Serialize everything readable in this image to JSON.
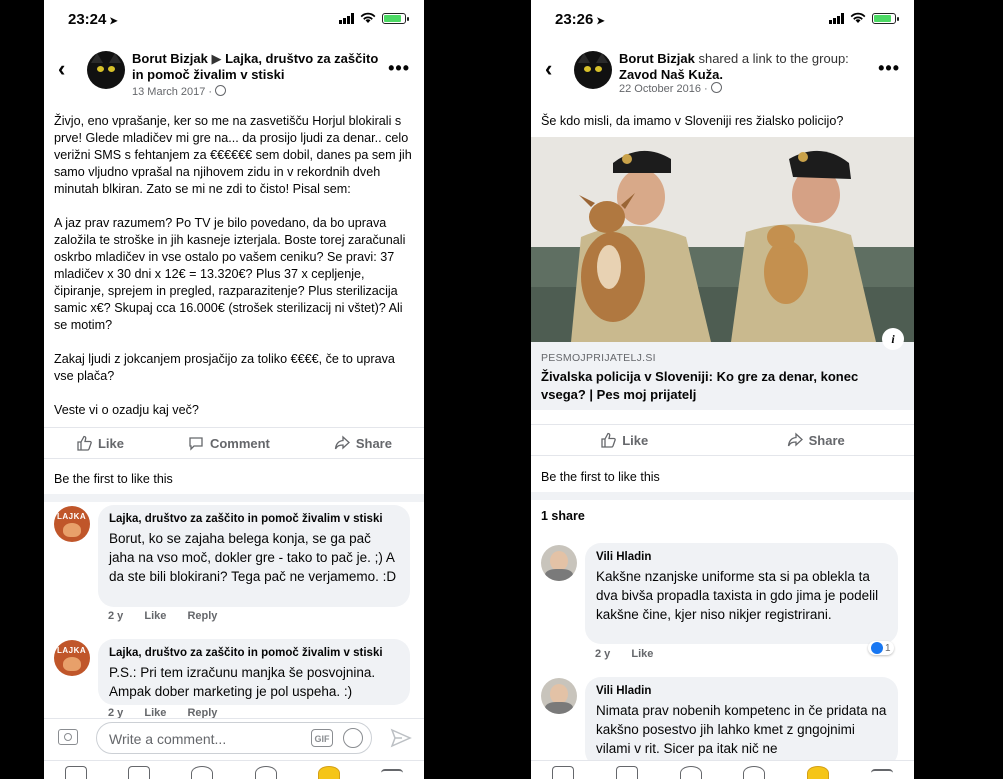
{
  "left": {
    "status": {
      "time": "23:24",
      "arrow": "➤"
    },
    "header": {
      "author": "Borut Bizjak",
      "separator": "▶",
      "group": "Lajka, društvo za zaščito in pomoč živalim v stiski",
      "date": "13 March 2017 ·"
    },
    "post": {
      "p1": "Živjo, eno vprašanje, ker so me na zasvetišču Horjul blokirali s prve! Glede mladičev mi gre na... da prosijo ljudi za denar.. celo verižni SMS s  fehtanjem za €€€€€€ sem dobil, danes pa sem jih samo vljudno vprašal na njihovem zidu in v rekordnih dveh minutah blkiran. Zato se mi ne zdi to čisto! Pisal sem:",
      "p2": "A jaz prav razumem? Po TV je bilo povedano, da bo uprava založila te stroške in jih kasneje izterjala. Boste torej zaračunali oskrbo mladičev in vse ostalo po vašem ceniku? Se pravi: 37 mladičev x 30 dni x 12€ = 13.320€? Plus 37 x cepljenje, čipiranje, sprejem in pregled, razparazitenje? Plus sterilizacija samic x€? Skupaj cca 16.000€ (strošek sterilizacij ni vštet)? Ali se motim?",
      "p3": "Zakaj ljudi z jokcanjem prosjačijo za toliko €€€€, če to uprava vse plača?",
      "p4": "Veste vi o ozadju kaj več?"
    },
    "actions": {
      "like": "Like",
      "comment": "Comment",
      "share": "Share"
    },
    "first_like": "Be the first to like this",
    "comments": [
      {
        "author": "Lajka, društvo za zaščito in pomoč živalim v stiski",
        "text": "Borut, ko se zajaha belega konja, se ga pač jaha na vso moč, dokler gre - tako to pač je. ;) A da ste bili blokirani? Tega pač ne verjamemo. :D",
        "age": "2 y",
        "like": "Like",
        "reply": "Reply"
      },
      {
        "author": "Lajka, društvo za zaščito in pomoč živalim v stiski",
        "text": "P.S.: Pri tem izračunu manjka še posvojnina. Ampak dober marketing je pol uspeha. :)",
        "age": "2 y",
        "like": "Like",
        "reply": "Reply"
      }
    ],
    "avatar_label": "LAJKA",
    "composer": {
      "placeholder": "Write a comment...",
      "gif": "GIF"
    }
  },
  "right": {
    "status": {
      "time": "23:26",
      "arrow": "➤"
    },
    "header": {
      "author": "Borut Bizjak",
      "action": "shared a link to the group:",
      "group": "Zavod Naš Kuža",
      "date": "22 October 2016 ·"
    },
    "post_text": "Še kdo misli, da imamo v Sloveniji res žialsko policijo?",
    "link": {
      "domain": "PESMOJPRIJATELJ.SI",
      "title": "Živalska policija v Sloveniji: Ko gre za denar, konec vsega? | Pes moj prijatelj",
      "info": "i"
    },
    "actions": {
      "like": "Like",
      "share": "Share"
    },
    "first_like": "Be the first to like this",
    "share_count": "1 share",
    "comments": [
      {
        "author": "Vili Hladin",
        "text": "Kakšne nzanjske uniforme sta si pa oblekla ta dva bivša propadla taxista in gdo jima je podelil kakšne čine, kjer niso nikjer registrirani.",
        "age": "2 y",
        "like": "Like",
        "reactions": "1"
      },
      {
        "author": "Vili Hladin",
        "text": "Nimata prav nobenih kompetenc in če pridata na kakšno posestvo jih lahko kmet z gngojnimi vilami v rit. Sicer pa itak nič ne"
      }
    ]
  },
  "colors": {
    "accent": "#1877f2",
    "bubble": "#f0f2f5",
    "meta": "#65676b",
    "battery": "#4cd964"
  }
}
